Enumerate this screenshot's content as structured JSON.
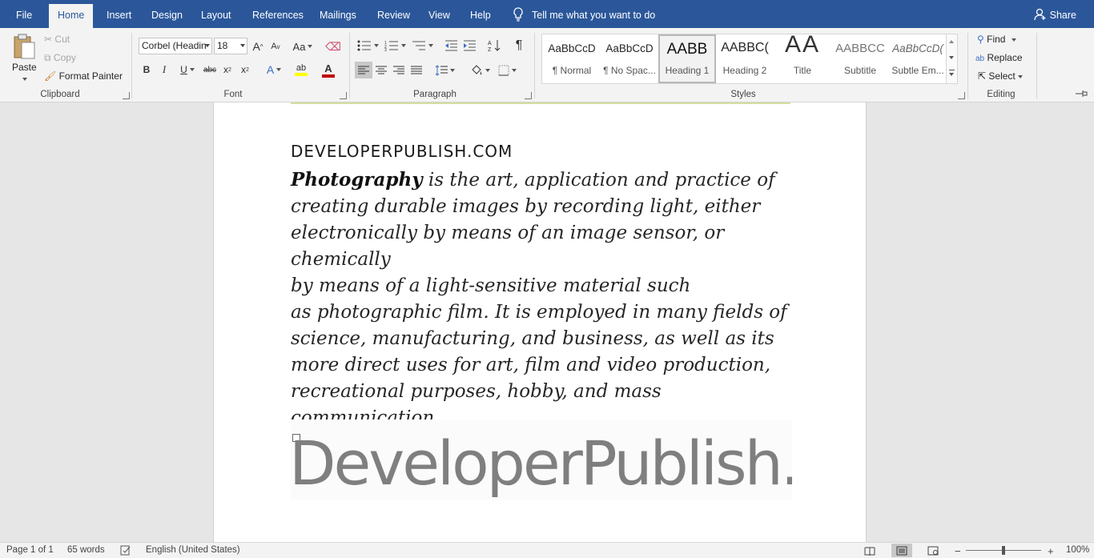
{
  "tabs": [
    {
      "label": "File"
    },
    {
      "label": "Home"
    },
    {
      "label": "Insert"
    },
    {
      "label": "Design"
    },
    {
      "label": "Layout"
    },
    {
      "label": "References"
    },
    {
      "label": "Mailings"
    },
    {
      "label": "Review"
    },
    {
      "label": "View"
    },
    {
      "label": "Help"
    }
  ],
  "active_tab": "Home",
  "tell_me": "Tell me what you want to do",
  "share": "Share",
  "clipboard": {
    "group": "Clipboard",
    "paste": "Paste",
    "cut": "Cut",
    "copy": "Copy",
    "format_painter": "Format Painter"
  },
  "font": {
    "group": "Font",
    "name": "Corbel (Headin",
    "size": "18",
    "grow": "A",
    "shrink": "A",
    "case": "Aa",
    "bold": "B",
    "italic": "I",
    "underline": "U",
    "strike": "abc",
    "subscript": "x",
    "superscript": "x",
    "text_effects": "A",
    "highlight": "ab",
    "font_color": "A",
    "font_color_value": "#c00000",
    "highlight_value": "#ffff00"
  },
  "paragraph": {
    "group": "Paragraph",
    "pilcrow": "¶"
  },
  "styles": {
    "group": "Styles",
    "items": [
      {
        "preview": "AaBbCcD",
        "name": "¶ Normal"
      },
      {
        "preview": "AaBbCcD",
        "name": "¶ No Spac..."
      },
      {
        "preview": "AABB",
        "name": "Heading 1"
      },
      {
        "preview": "AABBC(",
        "name": "Heading 2"
      },
      {
        "preview": "AA",
        "name": "Title"
      },
      {
        "preview": "AABBCC",
        "name": "Subtitle"
      },
      {
        "preview": "AaBbCcD(",
        "name": "Subtle Em..."
      }
    ],
    "selected": "Heading 1"
  },
  "editing": {
    "group": "Editing",
    "find": "Find",
    "replace": "Replace",
    "select": "Select"
  },
  "document": {
    "heading": "DEVELOPERPUBLISH.COM",
    "lead_word": "Photography",
    "body": " is the art, application and practice of\ncreating durable images by recording light, either\nelectronically by means of an image sensor, or chemically\nby means of a light-sensitive material such\nas photographic film. It is employed in many fields of\nscience, manufacturing, and business, as well as its\nmore direct uses for art, film and video production,\nrecreational purposes, hobby, and mass communication.",
    "image_text": "DeveloperPublish.com"
  },
  "status": {
    "page": "Page 1 of 1",
    "words": "65 words",
    "language": "English (United States)",
    "zoom_minus": "−",
    "zoom_plus": "+",
    "zoom": "100%"
  }
}
